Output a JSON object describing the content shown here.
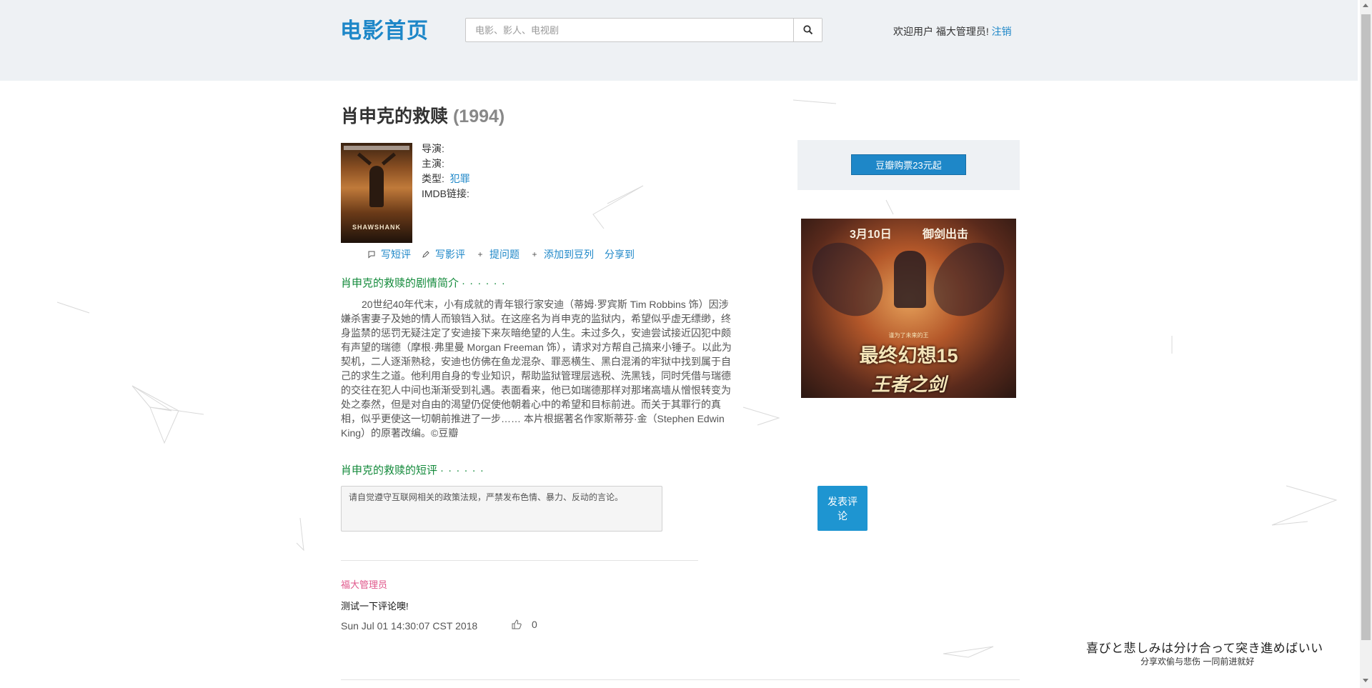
{
  "header": {
    "logo": "电影首页",
    "search_placeholder": "电影、影人、电视剧",
    "welcome_prefix": "欢迎用户 ",
    "username": "福大管理员!",
    "logout": "注销"
  },
  "movie": {
    "title": "肖申克的救赎",
    "year": "(1994)",
    "director_label": "导演:",
    "cast_label": "主演:",
    "genre_label": "类型:",
    "genre": "犯罪",
    "imdb_label": "IMDB链接:",
    "poster_title": "SHAWSHANK"
  },
  "actions": [
    {
      "label": "写短评",
      "icon": "speech-bubble-icon"
    },
    {
      "label": "写影评",
      "icon": "pencil-icon"
    },
    {
      "label": "提问题",
      "icon": "plus-icon"
    },
    {
      "label": "添加到豆列",
      "icon": "plus-icon"
    },
    {
      "label": "分享到",
      "icon": ""
    }
  ],
  "synopsis": {
    "heading": "肖申克的救赎的剧情简介",
    "dots": "· · · · · ·",
    "text": "20世纪40年代末，小有成就的青年银行家安迪（蒂姆·罗宾斯 Tim Robbins 饰）因涉嫌杀害妻子及她的情人而锒铛入狱。在这座名为肖申克的监狱内，希望似乎虚无缥缈，终身监禁的惩罚无疑注定了安迪接下来灰暗绝望的人生。未过多久，安迪尝试接近囚犯中颇有声望的瑞德（摩根·弗里曼 Morgan Freeman 饰），请求对方帮自己搞来小锤子。以此为契机，二人逐渐熟稔，安迪也仿佛在鱼龙混杂、罪恶横生、黑白混淆的牢狱中找到属于自己的求生之道。他利用自身的专业知识，帮助监狱管理层逃税、洗黑钱，同时凭借与瑞德的交往在犯人中间也渐渐受到礼遇。表面看来，他已如瑞德那样对那堵高墙从憎恨转变为处之泰然，但是对自由的渴望仍促使他朝着心中的希望和目标前进。而关于其罪行的真相，似乎更使这一切朝前推进了一步…… 本片根据著名作家斯蒂芬·金（Stephen Edwin King）的原著改编。©豆瓣"
  },
  "reviews": {
    "heading": "肖申克的救赎的短评",
    "dots": "· · · · · ·",
    "placeholder": "请自觉遵守互联网相关的政策法规，严禁发布色情、暴力、反动的言论。",
    "post_button": "发表评论"
  },
  "comment": {
    "user": "福大管理员",
    "text": "测试一下评论噢!",
    "time": "Sun Jul 01 14:30:07 CST 2018",
    "likes": "0"
  },
  "sidebar": {
    "buy_button": "豆瓣购票23元起",
    "ad_date": "3月10日",
    "ad_slogan": "御剑出击",
    "ad_tag": "谨为了未来的王",
    "ad_title": "最终幻想15",
    "ad_subtitle": "王者之剑"
  },
  "lyric": {
    "line1": "喜びと悲しみは分け合って突き進めばいい",
    "line2": "分享欢偷与悲伤 一同前进就好"
  },
  "colors": {
    "accent": "#1e87c8",
    "section_green": "#138a3b",
    "username_pink": "#e0578b",
    "header_bg": "#eef1f4"
  }
}
